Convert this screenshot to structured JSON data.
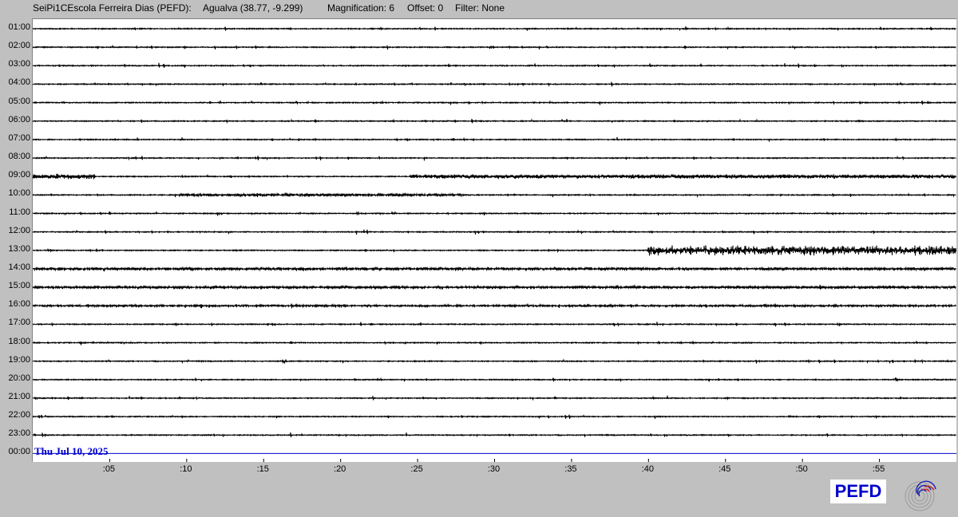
{
  "header": {
    "station": "SeiPi1CEscola Ferreira Dias (PEFD):",
    "location": "Agualva (38.77, -9.299)",
    "magnification": "Magnification: 6",
    "offset": "Offset: 0",
    "filter": "Filter: None"
  },
  "chart_data": {
    "type": "line",
    "title": "",
    "hour_labels": [
      "01:00",
      "02:00",
      "03:00",
      "04:00",
      "05:00",
      "06:00",
      "07:00",
      "08:00",
      "09:00",
      "10:00",
      "11:00",
      "12:00",
      "13:00",
      "14:00",
      "15:00",
      "16:00",
      "17:00",
      "18:00",
      "19:00",
      "20:00",
      "21:00",
      "22:00",
      "23:00",
      "00:00"
    ],
    "minute_labels": [
      ":05",
      ":10",
      ":15",
      ":20",
      ":25",
      ":30",
      ":35",
      ":40",
      ":45",
      ":50",
      ":55"
    ],
    "minute_ticks": [
      5,
      10,
      15,
      20,
      25,
      30,
      35,
      40,
      45,
      50,
      55
    ],
    "xlim": [
      0,
      60
    ],
    "date_label": "Thu Jul 10, 2025",
    "trace_color": "#000000",
    "current_trace_color": "#0000cc",
    "activity": [
      {
        "row": 5,
        "bursts": [
          {
            "minute": 25.2,
            "amplitude": 10
          },
          {
            "minute": 31.5,
            "amplitude": 7
          }
        ]
      },
      {
        "row": 6,
        "bursts": [
          {
            "minute": 18.5,
            "amplitude": 4
          },
          {
            "minute": 22.5,
            "amplitude": 5
          },
          {
            "minute": 25.5,
            "amplitude": 4
          },
          {
            "minute": 41.3,
            "amplitude": 11
          },
          {
            "minute": 45.2,
            "amplitude": 8
          }
        ]
      },
      {
        "row": 7,
        "bursts": [
          {
            "minute": 50.5,
            "amplitude": 4
          },
          {
            "minute": 53.0,
            "amplitude": 12
          },
          {
            "minute": 57.0,
            "amplitude": 9
          },
          {
            "minute": 58.5,
            "amplitude": 5
          }
        ]
      },
      {
        "row": 8,
        "bursts": [
          {
            "minute": 0.4,
            "amplitude": 5
          },
          {
            "minute": 3.5,
            "amplitude": 6
          },
          {
            "minute": 27.2,
            "amplitude": 5
          },
          {
            "minute": 37.5,
            "amplitude": 5
          },
          {
            "minute": 42.5,
            "amplitude": 4
          }
        ]
      },
      {
        "row": 9,
        "bursts": [
          {
            "minute": 9.5,
            "amplitude": 4
          },
          {
            "minute": 13.5,
            "amplitude": 5
          },
          {
            "minute": 28.5,
            "amplitude": 6
          }
        ]
      },
      {
        "row": 11,
        "bursts": [
          {
            "minute": 12.5,
            "amplitude": 3
          },
          {
            "minute": 55.5,
            "amplitude": 5
          }
        ]
      },
      {
        "row": 12,
        "bursts": [
          {
            "minute": 41.5,
            "amplitude": 10
          },
          {
            "minute": 45.5,
            "amplitude": 8
          },
          {
            "minute": 56.0,
            "amplitude": 9
          }
        ]
      },
      {
        "row": 13,
        "bursts": [
          {
            "minute": 1.0,
            "amplitude": 6
          },
          {
            "minute": 5.0,
            "amplitude": 6
          },
          {
            "minute": 9.5,
            "amplitude": 8
          },
          {
            "minute": 18.0,
            "amplitude": 5
          },
          {
            "minute": 25.5,
            "amplitude": 5
          },
          {
            "minute": 45.5,
            "amplitude": 4
          }
        ]
      },
      {
        "row": 14,
        "bursts": [
          {
            "minute": 2.5,
            "amplitude": 6
          },
          {
            "minute": 9.0,
            "amplitude": 6
          },
          {
            "minute": 11.2,
            "amplitude": 6
          },
          {
            "minute": 21.5,
            "amplitude": 8
          },
          {
            "minute": 35.0,
            "amplitude": 5
          },
          {
            "minute": 36.5,
            "amplitude": 6
          },
          {
            "minute": 45.5,
            "amplitude": 7
          },
          {
            "minute": 47.5,
            "amplitude": 6
          }
        ]
      },
      {
        "row": 15,
        "bursts": [
          {
            "minute": 36.8,
            "amplitude": 9
          },
          {
            "minute": 38.0,
            "amplitude": 7
          },
          {
            "minute": 50.2,
            "amplitude": 10
          }
        ]
      },
      {
        "row": 16,
        "bursts": [
          {
            "minute": 10.5,
            "amplitude": 3
          }
        ]
      },
      {
        "row": 17,
        "bursts": [
          {
            "minute": 2.3,
            "amplitude": 5
          },
          {
            "minute": 11.2,
            "amplitude": 8
          },
          {
            "minute": 57.3,
            "amplitude": 5
          }
        ]
      },
      {
        "row": 18,
        "bursts": [
          {
            "minute": 13.6,
            "amplitude": 5
          },
          {
            "minute": 29.0,
            "amplitude": 5
          },
          {
            "minute": 33.0,
            "amplitude": 4
          }
        ]
      },
      {
        "row": 22,
        "bursts": [
          {
            "minute": 19.5,
            "amplitude": 3
          }
        ]
      }
    ],
    "sustained": [
      {
        "row": 8,
        "start": 24.5,
        "end": 60,
        "amplitude": 3
      },
      {
        "row": 8,
        "start": 0,
        "end": 4,
        "amplitude": 4
      },
      {
        "row": 9,
        "start": 9.5,
        "end": 28,
        "amplitude": 2
      },
      {
        "row": 12,
        "start": 40.0,
        "end": 60,
        "amplitude": 7
      },
      {
        "row": 13,
        "start": 0,
        "end": 60,
        "amplitude": 2
      },
      {
        "row": 14,
        "start": 0,
        "end": 60,
        "amplitude": 2
      },
      {
        "row": 15,
        "start": 0,
        "end": 60,
        "amplitude": 1.5
      }
    ]
  },
  "station_badge": "PEFD",
  "logo_icon": "seismograph-spiral-icon"
}
